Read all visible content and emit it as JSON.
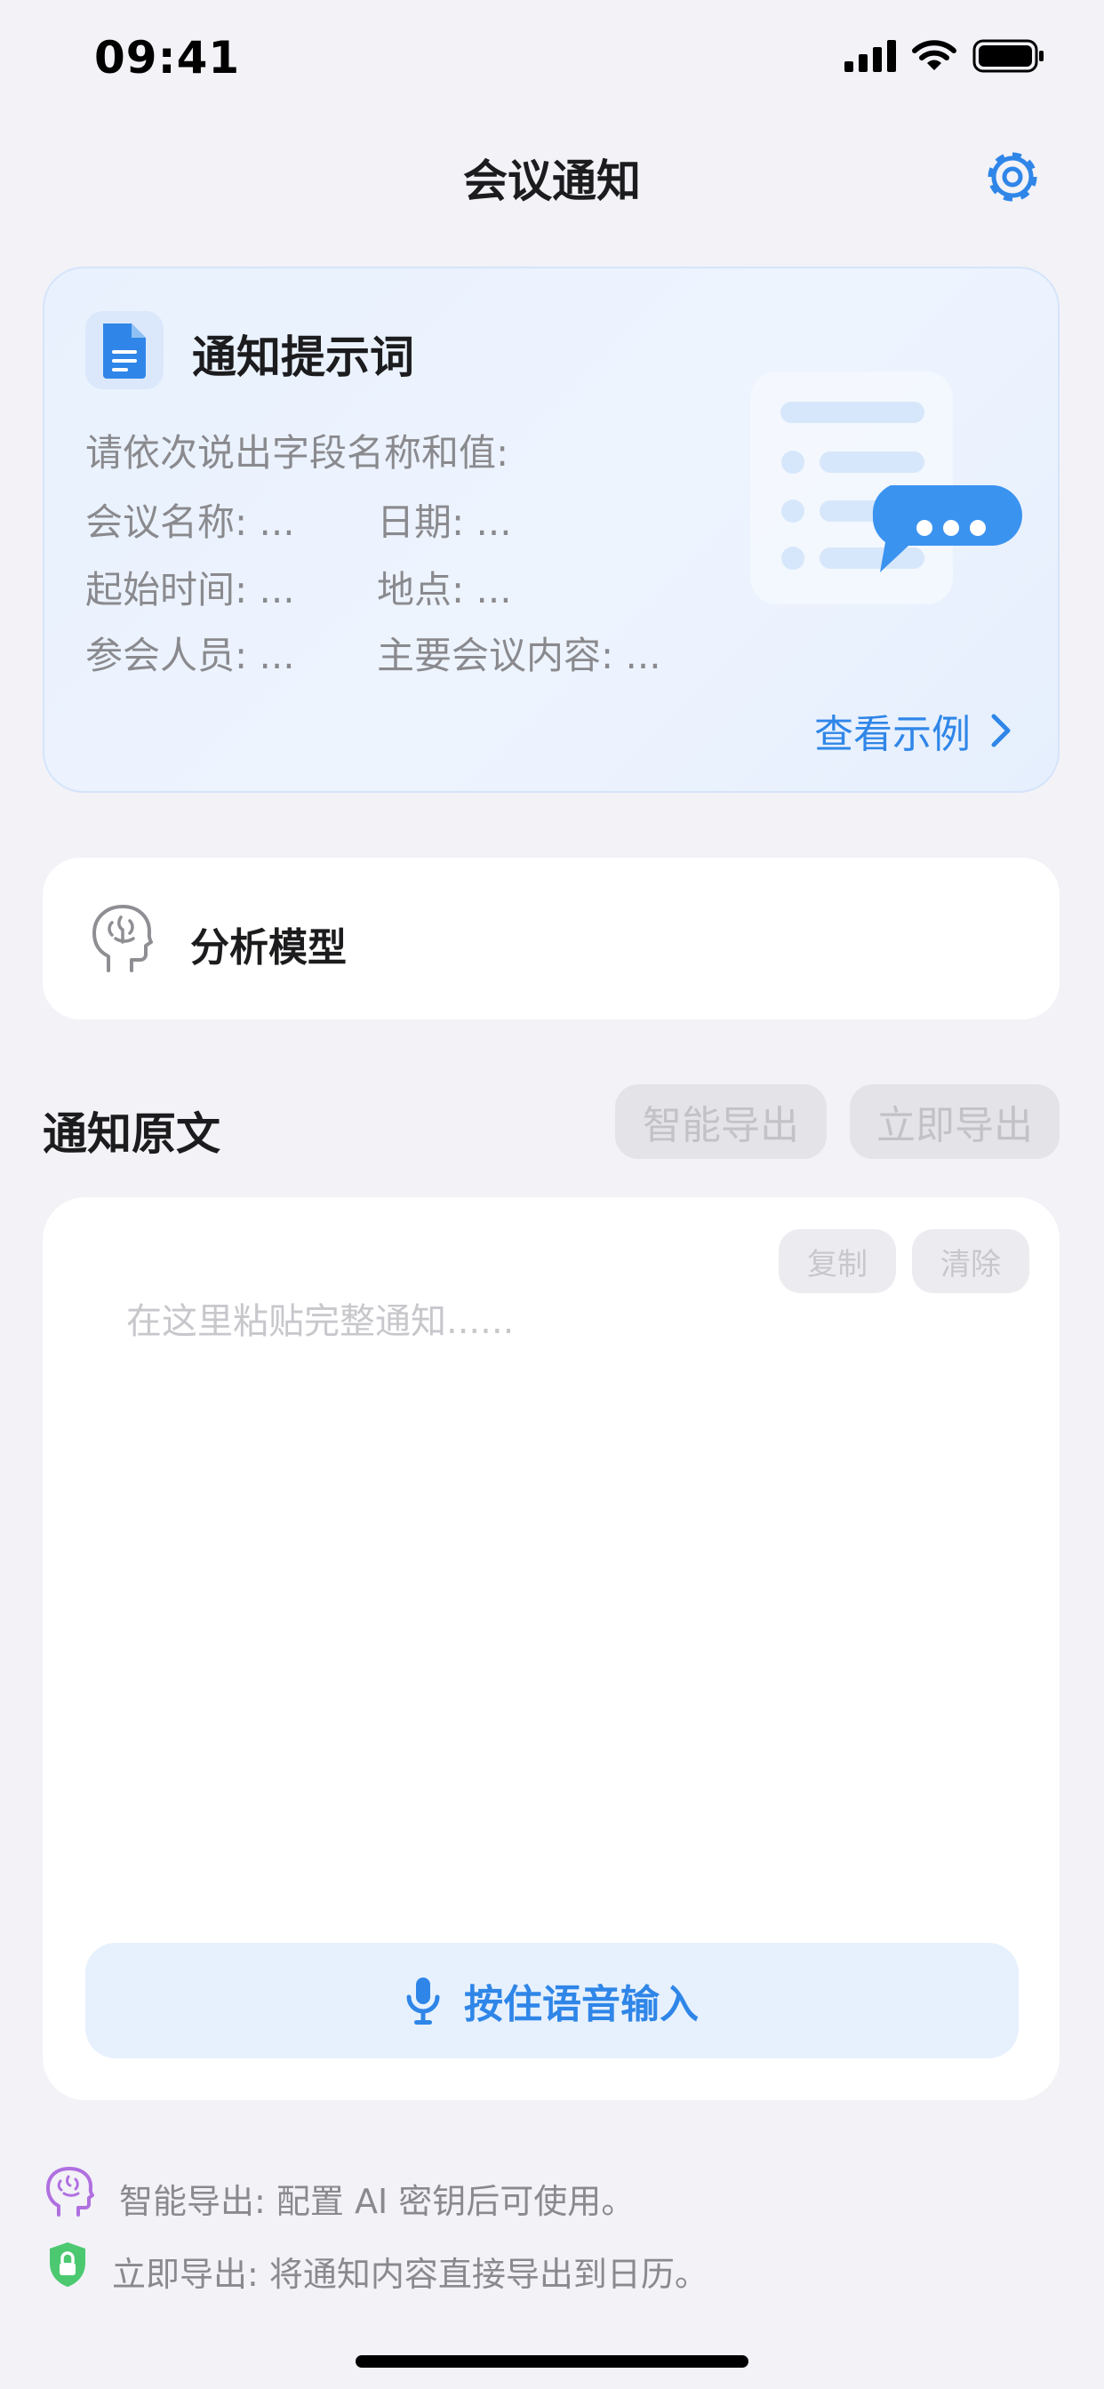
{
  "status_bar": {
    "time": "09:41"
  },
  "nav": {
    "title": "会议通知"
  },
  "prompt_card": {
    "title": "通知提示词",
    "intro": "请依次说出字段名称和值:",
    "fields": [
      "会议名称: ...",
      "日期: ...",
      "起始时间: ...",
      "地点: ...",
      "参会人员: ...",
      "主要会议内容: ..."
    ],
    "view_example": "查看示例"
  },
  "model": {
    "label": "分析模型"
  },
  "section": {
    "title": "通知原文",
    "smart_export": "智能导出",
    "instant_export": "立即导出"
  },
  "editor": {
    "copy": "复制",
    "clear": "清除",
    "placeholder": "在这里粘贴完整通知......",
    "voice_button": "按住语音输入"
  },
  "notes": [
    {
      "icon": "brain-icon",
      "text": "智能导出: 配置 AI 密钥后可使用。"
    },
    {
      "icon": "shield-lock-icon",
      "text": "立即导出: 将通知内容直接导出到日历。"
    }
  ],
  "colors": {
    "accent": "#2f86e8",
    "background": "#f2f2f7",
    "brain_icon": "#b070e0",
    "shield_icon": "#4cc970"
  }
}
